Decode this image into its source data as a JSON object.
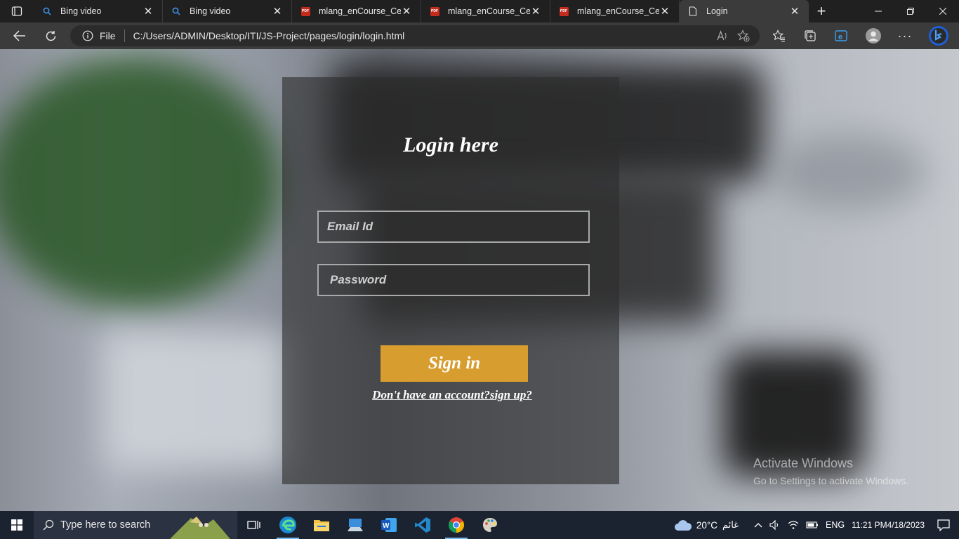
{
  "browser": {
    "tabs": [
      {
        "title": "Bing video",
        "icon": "search-icon"
      },
      {
        "title": "Bing video",
        "icon": "search-icon"
      },
      {
        "title": "mlang_enCourse_Certi",
        "icon": "pdf-icon"
      },
      {
        "title": "mlang_enCourse_Certi",
        "icon": "pdf-icon"
      },
      {
        "title": "mlang_enCourse_Certi",
        "icon": "pdf-icon"
      },
      {
        "title": "Login",
        "icon": "page-icon",
        "active": true
      }
    ],
    "address": {
      "scheme": "File",
      "url": "C:/Users/ADMIN/Desktop/ITI/JS-Project/pages/login/login.html"
    }
  },
  "login": {
    "title": "Login here",
    "email_placeholder": "Email Id",
    "password_placeholder": "Password",
    "signin_label": "Sign in",
    "signup_link": "Don't have an account?sign up?",
    "accent_color": "#d79d2f"
  },
  "watermark": {
    "line1": "Activate Windows",
    "line2": "Go to Settings to activate Windows."
  },
  "taskbar": {
    "search_placeholder": "Type here to search",
    "weather": "20°C",
    "weather_desc": "غائم",
    "language": "ENG",
    "time": "11:21 PM",
    "date": "4/18/2023"
  }
}
